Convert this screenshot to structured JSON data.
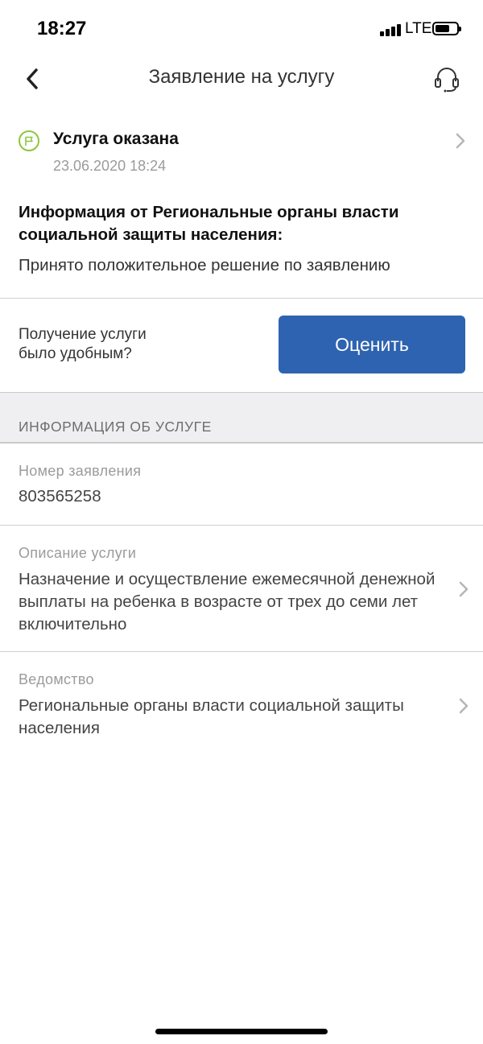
{
  "status_bar": {
    "time": "18:27",
    "network": "LTE"
  },
  "nav": {
    "title": "Заявление на услугу",
    "back_icon": "chevron-left-icon",
    "support_icon": "headset-icon"
  },
  "application_status": {
    "title": "Услуга оказана",
    "date": "23.06.2020 18:24",
    "icon": "flag-icon",
    "accent_color": "#8dc63f"
  },
  "info": {
    "heading": "Информация от Региональные органы власти социальной защиты населения:",
    "message": "Принято положительное решение по заявлению"
  },
  "rating": {
    "question": "Получение услуги было удобным?",
    "button_label": "Оценить",
    "button_color": "#2e63b1"
  },
  "service_info": {
    "section_title": "ИНФОРМАЦИЯ ОБ УСЛУГЕ",
    "fields": [
      {
        "label": "Номер заявления",
        "value": "803565258"
      },
      {
        "label": "Описание услуги",
        "value": "Назначение и осуществление ежемесячной денежной выплаты на ребенка в возрасте от трех до семи лет включительно"
      },
      {
        "label": "Ведомство",
        "value": "Региональные органы власти социальной защиты населения"
      }
    ]
  }
}
